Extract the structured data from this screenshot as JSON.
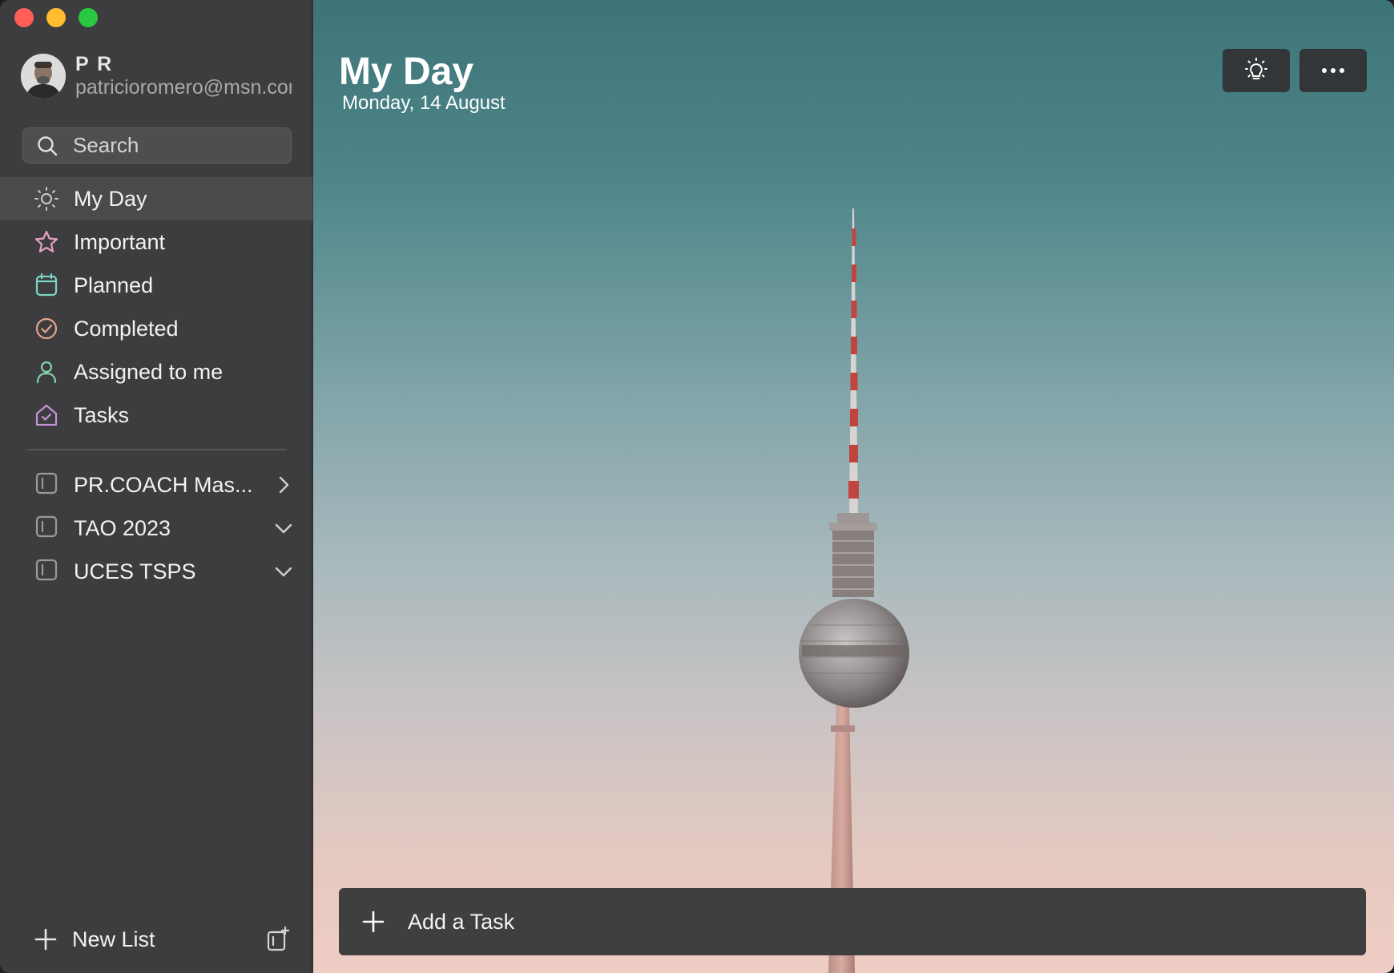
{
  "window": {
    "controls": {
      "close_color": "#ff5f57",
      "minimize_color": "#febc2e",
      "maximize_color": "#28c840"
    }
  },
  "profile": {
    "name": "P R",
    "email": "patricioromero@msn.com"
  },
  "search": {
    "placeholder": "Search",
    "icon": "search-icon"
  },
  "nav": {
    "items": [
      {
        "label": "My Day",
        "icon": "sun-icon",
        "color": "#c9c9c9",
        "active": true
      },
      {
        "label": "Important",
        "icon": "star-icon",
        "color": "#e7a1c0"
      },
      {
        "label": "Planned",
        "icon": "calendar-icon",
        "color": "#7dd3c7"
      },
      {
        "label": "Completed",
        "icon": "check-circle-icon",
        "color": "#e8a48a"
      },
      {
        "label": "Assigned to me",
        "icon": "person-icon",
        "color": "#82d3a8"
      },
      {
        "label": "Tasks",
        "icon": "home-icon",
        "color": "#c593d8"
      }
    ]
  },
  "lists": {
    "items": [
      {
        "label": "PR.COACH Mas...",
        "icon": "list-group-icon",
        "chevron": "chevron-right-icon"
      },
      {
        "label": "TAO 2023",
        "icon": "list-group-icon",
        "chevron": "chevron-down-icon"
      },
      {
        "label": "UCES TSPS",
        "icon": "list-group-icon",
        "chevron": "chevron-down-icon"
      }
    ]
  },
  "footer": {
    "new_list_label": "New List",
    "new_group_icon": "new-group-icon"
  },
  "main": {
    "title": "My Day",
    "date": "Monday, 14 August",
    "suggestions_icon": "lightbulb-icon",
    "more_icon": "more-icon",
    "add_task_placeholder": "Add a Task"
  }
}
